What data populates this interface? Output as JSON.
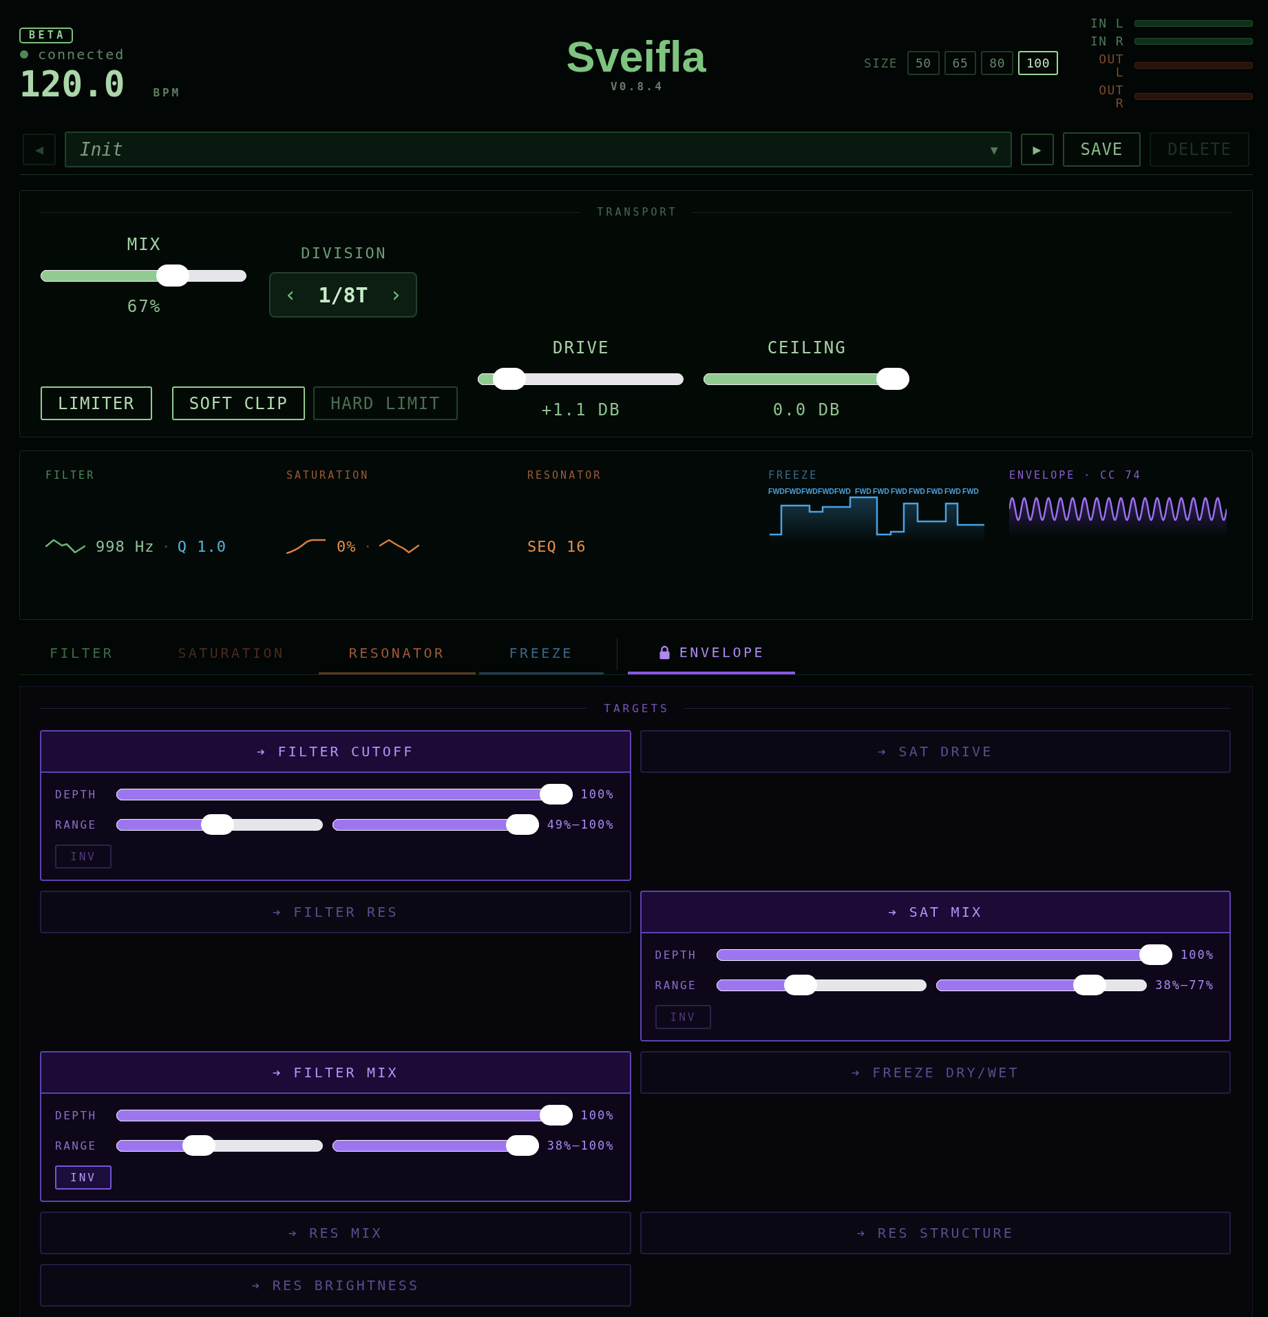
{
  "header": {
    "badge": "BETA",
    "status": {
      "label": "connected",
      "connected": true
    },
    "bpm": {
      "value": "120.0",
      "unit": "BPM"
    },
    "title": "Sveifla",
    "version": "V0.8.4",
    "size": {
      "label": "SIZE",
      "options": [
        {
          "label": "50",
          "selected": false
        },
        {
          "label": "65",
          "selected": false
        },
        {
          "label": "80",
          "selected": false
        },
        {
          "label": "100",
          "selected": true
        }
      ]
    },
    "meters": [
      {
        "label": "IN L",
        "kind": "input"
      },
      {
        "label": "IN R",
        "kind": "input"
      },
      {
        "label": "OUT L",
        "kind": "output"
      },
      {
        "label": "OUT R",
        "kind": "output"
      }
    ]
  },
  "preset_bar": {
    "prev": {
      "glyph": "◀",
      "disabled": true
    },
    "preset": {
      "value": "Init",
      "caret": "▼"
    },
    "next": {
      "glyph": "▶",
      "disabled": false
    },
    "actions": [
      {
        "label": "SAVE",
        "disabled": false
      },
      {
        "label": "DELETE",
        "disabled": true
      }
    ]
  },
  "transport": {
    "title": "TRANSPORT",
    "mix": {
      "label": "MIX",
      "level": 0.67,
      "value": "67%"
    },
    "division": {
      "label": "DIVISION",
      "prev": "‹",
      "value": "1/8T",
      "next": "›"
    },
    "limiter": {
      "label": "LIMITER",
      "on": true
    },
    "clip_modes": [
      {
        "label": "SOFT CLIP",
        "selected": true
      },
      {
        "label": "HARD LIMIT",
        "selected": false
      }
    ],
    "drive": {
      "label": "DRIVE",
      "level": 0.09,
      "value": "+1.1 DB"
    },
    "ceiling": {
      "label": "CEILING",
      "level": 1,
      "value": "0.0 DB"
    }
  },
  "modules": [
    {
      "kind": "filter",
      "label": "FILTER",
      "color": "#4e8a5a",
      "value": "998 Hz",
      "separator": "·",
      "q": "Q 1.0"
    },
    {
      "kind": "saturation",
      "label": "SATURATION",
      "color": "#9a5b3a",
      "value": "0%",
      "separator": "·"
    },
    {
      "kind": "resonator",
      "label": "RESONATOR",
      "color": "#9a5b3a",
      "value": "SEQ 16"
    },
    {
      "kind": "freeze",
      "label": "FREEZE",
      "color": "#3b6a8a",
      "step_labels": [
        "FWD",
        "FWD",
        "FWD",
        "FWD",
        "FWD",
        "FWD",
        "FWD",
        "FWD",
        "FWD",
        "FWD",
        "FWD",
        "FWD"
      ]
    },
    {
      "kind": "envelope",
      "label": "ENVELOPE · CC 74",
      "color": "#8a5ed0"
    }
  ],
  "tabs": [
    {
      "kind": "module",
      "label": "FILTER",
      "color": "#3e6b48",
      "selected": false,
      "enabled": false,
      "locked": false
    },
    {
      "kind": "module",
      "label": "SATURATION",
      "color": "#4a2b1d",
      "selected": false,
      "enabled": false,
      "locked": false
    },
    {
      "kind": "module",
      "label": "RESONATOR",
      "color": "#9a5a38",
      "selected": false,
      "enabled": true,
      "locked": false
    },
    {
      "kind": "module",
      "label": "FREEZE",
      "color": "#3b6688",
      "selected": false,
      "enabled": true,
      "locked": false
    },
    {
      "kind": "modulator",
      "label": "ENVELOPE",
      "color": "#8a56e8",
      "selected": true,
      "enabled": true,
      "locked": true
    }
  ],
  "targets": {
    "title": "TARGETS",
    "items": [
      {
        "label": "➔ FILTER CUTOFF",
        "expanded": true,
        "depth": {
          "label": "DEPTH",
          "level": 1,
          "value": "100%"
        },
        "range": {
          "label": "RANGE",
          "sliders": [
            {
              "level": 0.49
            },
            {
              "level": 1
            }
          ],
          "value": "49%–100%"
        },
        "invert": {
          "label": "INV",
          "on": false
        }
      },
      {
        "label": "➔ SAT DRIVE",
        "expanded": false
      },
      {
        "label": "➔ FILTER RES",
        "expanded": false
      },
      {
        "label": "➔ SAT MIX",
        "expanded": true,
        "depth": {
          "label": "DEPTH",
          "level": 1,
          "value": "100%"
        },
        "range": {
          "label": "RANGE",
          "sliders": [
            {
              "level": 0.38
            },
            {
              "level": 0.77
            }
          ],
          "value": "38%–77%"
        },
        "invert": {
          "label": "INV",
          "on": false
        }
      },
      {
        "label": "➔ FILTER MIX",
        "expanded": true,
        "depth": {
          "label": "DEPTH",
          "level": 1,
          "value": "100%"
        },
        "range": {
          "label": "RANGE",
          "sliders": [
            {
              "level": 0.38
            },
            {
              "level": 1
            }
          ],
          "value": "38%–100%"
        },
        "invert": {
          "label": "INV",
          "on": true
        }
      },
      {
        "label": "➔ FREEZE DRY/WET",
        "expanded": false
      },
      {
        "label": "➔ RES MIX",
        "expanded": false
      },
      {
        "label": "➔ RES STRUCTURE",
        "expanded": false
      },
      {
        "label": "➔ RES BRIGHTNESS",
        "expanded": false
      }
    ]
  }
}
